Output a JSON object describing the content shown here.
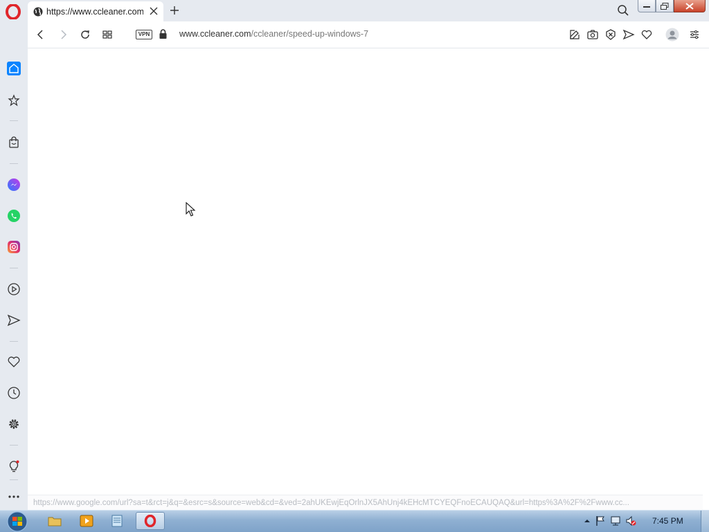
{
  "browser": {
    "name": "Opera",
    "tab": {
      "title": "https://www.ccleaner.com/"
    },
    "address": {
      "vpn_label": "VPN",
      "url_host": "www.ccleaner.com",
      "url_path": "/ccleaner/speed-up-windows-7"
    },
    "status_url": "https://www.google.com/url?sa=t&rct=j&q=&esrc=s&source=web&cd=&ved=2ahUKEwjEqOrlnJX5AhUnj4kEHcMTCYEQFnoECAUQAQ&url=https%3A%2F%2Fwww.cc...",
    "accent_color": "#0a84ff",
    "sidebar": {
      "items": [
        {
          "name": "home-icon"
        },
        {
          "name": "speed-dial-star-icon"
        },
        {
          "name": "shopping-bag-icon"
        },
        {
          "name": "messenger-icon"
        },
        {
          "name": "whatsapp-icon"
        },
        {
          "name": "instagram-icon"
        },
        {
          "name": "player-icon"
        },
        {
          "name": "send-icon"
        },
        {
          "name": "heart-icon"
        },
        {
          "name": "history-icon"
        },
        {
          "name": "settings-icon"
        },
        {
          "name": "lightbulb-icon"
        },
        {
          "name": "more-icon"
        }
      ]
    }
  },
  "taskbar": {
    "clock": "7:45 PM",
    "apps": [
      "file-explorer",
      "media-player",
      "notepad",
      "opera"
    ]
  }
}
